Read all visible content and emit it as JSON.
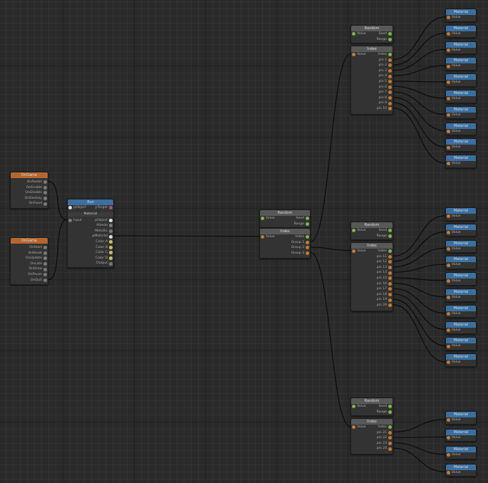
{
  "colors": {
    "event_header": "#b5672f",
    "material_header": "#3b6fa0",
    "utility_header": "#585858",
    "wire": "#0d0d0d"
  },
  "events_a": {
    "title": "OnGame",
    "ports": [
      "OnAwake",
      "OnEnable",
      "OnDisable",
      "OnDestroy",
      "OnFixed"
    ]
  },
  "events_b": {
    "title": "OnGame",
    "ports": [
      "OnStart",
      "OnReset",
      "OnUpdate",
      "OnLate",
      "OnDraw",
      "OnPause",
      "OnQuit"
    ]
  },
  "run_node": {
    "title": "Run",
    "in_label": "pObject",
    "out_label": "pTarget"
  },
  "material_node": {
    "title": "Material",
    "in_label": "Input",
    "ports": [
      "pObject",
      "Albedo",
      "Metallic",
      "pMaterial",
      "Color A",
      "Color B",
      "Color C",
      "Color D",
      "Output"
    ]
  },
  "center_random": {
    "title": "Random",
    "in_label": "Value",
    "ports": [
      "Seed",
      "Range"
    ]
  },
  "center_index": {
    "title": "Index",
    "in_label": "Value",
    "ports": [
      "Index",
      "Group 1",
      "Group 2",
      "Group 3"
    ]
  },
  "top_random": {
    "title": "Random",
    "in_label": "Value",
    "ports": [
      "Seed",
      "Range"
    ]
  },
  "top_index": {
    "title": "Index",
    "in_label": "Value",
    "ports": [
      "Index",
      "pin 1",
      "pin 2",
      "pin 3",
      "pin 4",
      "pin 5",
      "pin 6",
      "pin 7",
      "pin 8",
      "pin 9",
      "pin 10"
    ]
  },
  "mid_random": {
    "title": "Random",
    "in_label": "Value",
    "ports": [
      "Seed",
      "Range"
    ]
  },
  "mid_index": {
    "title": "Index",
    "in_label": "Value",
    "ports": [
      "Index",
      "pin 11",
      "pin 12",
      "pin 13",
      "pin 14",
      "pin 15",
      "pin 16",
      "pin 17",
      "pin 18",
      "pin 19",
      "pin 20"
    ]
  },
  "bot_random": {
    "title": "Random",
    "in_label": "Value",
    "ports": [
      "Seed",
      "Range"
    ]
  },
  "bot_index": {
    "title": "Index",
    "in_label": "Value",
    "ports": [
      "Index",
      "pin 21",
      "pin 22",
      "pin 23",
      "pin 24"
    ]
  },
  "material_out": {
    "title": "Material",
    "port": "Value"
  }
}
